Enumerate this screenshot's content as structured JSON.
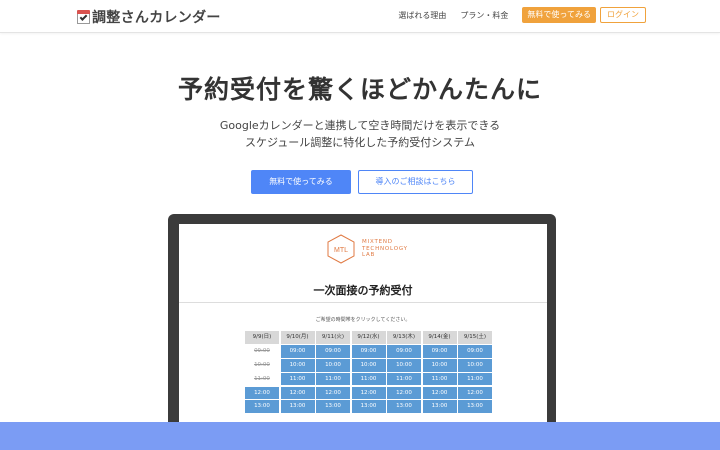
{
  "header": {
    "logo_text": "調整さんカレンダー",
    "nav_links": [
      "選ばれる理由",
      "プラン・料金"
    ],
    "free_button": "無料で使ってみる",
    "login_button": "ログイン"
  },
  "hero": {
    "title": "予約受付を驚くほどかんたんに",
    "subtitle_line1": "Googleカレンダーと連携して空き時間だけを表示できる",
    "subtitle_line2": "スケジュール調整に特化した予約受付システム",
    "cta_primary": "無料で使ってみる",
    "cta_secondary": "導入のご相談はこちら"
  },
  "preview": {
    "logo_mark": "MTL",
    "logo_lines": [
      "MIXTEND",
      "TECHNOLOGY",
      "LAB"
    ],
    "title": "一次面接の予約受付",
    "prompt": "ご希望の時間帯をクリックしてください。",
    "next_icon": "›",
    "days": [
      "9/9(日)",
      "9/10(月)",
      "9/11(火)",
      "9/12(水)",
      "9/13(木)",
      "9/14(金)",
      "9/15(土)"
    ],
    "rows": [
      {
        "time": "09:00",
        "first_past": true
      },
      {
        "time": "10:00",
        "first_past": true
      },
      {
        "time": "11:00",
        "first_past": true
      },
      {
        "time": "12:00",
        "first_past": false
      },
      {
        "time": "13:00",
        "first_past": false
      }
    ]
  },
  "colors": {
    "accent_orange": "#f0a23c",
    "accent_blue": "#4f86f7",
    "slot_blue": "#5b9bd5",
    "mtl_orange": "#e07a43",
    "bottom_bar": "#7b9cf4"
  }
}
